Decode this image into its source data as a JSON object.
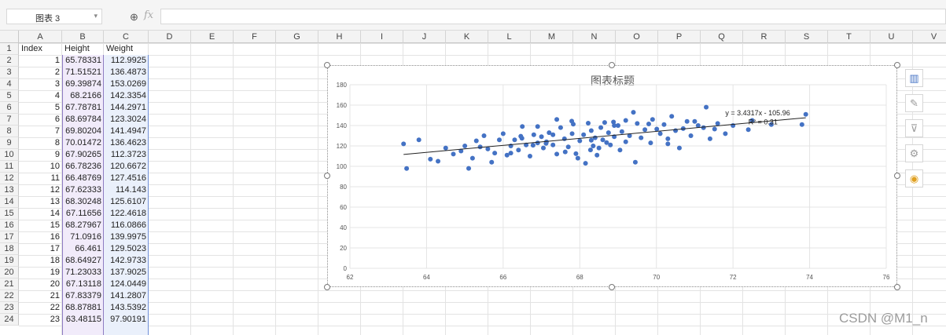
{
  "toolbar": {
    "name_box_value": "图表 3",
    "fx_label": "fx",
    "formula_value": ""
  },
  "columns": [
    "A",
    "B",
    "C",
    "D",
    "E",
    "F",
    "G",
    "H",
    "I",
    "J",
    "K",
    "L",
    "M",
    "N",
    "O",
    "P",
    "Q",
    "R",
    "S",
    "T",
    "U",
    "V"
  ],
  "row_numbers": [
    "1",
    "2",
    "3",
    "4",
    "5",
    "6",
    "7",
    "8",
    "9",
    "10",
    "11",
    "12",
    "13",
    "14",
    "15",
    "16",
    "17",
    "18",
    "19",
    "20",
    "21",
    "22",
    "23",
    "24"
  ],
  "header_row": [
    "Index",
    "Height",
    "Weight"
  ],
  "rows": [
    [
      "1",
      "65.78331",
      "112.9925"
    ],
    [
      "2",
      "71.51521",
      "136.4873"
    ],
    [
      "3",
      "69.39874",
      "153.0269"
    ],
    [
      "4",
      "68.2166",
      "142.3354"
    ],
    [
      "5",
      "67.78781",
      "144.2971"
    ],
    [
      "6",
      "68.69784",
      "123.3024"
    ],
    [
      "7",
      "69.80204",
      "141.4947"
    ],
    [
      "8",
      "70.01472",
      "136.4623"
    ],
    [
      "9",
      "67.90265",
      "112.3723"
    ],
    [
      "10",
      "66.78236",
      "120.6672"
    ],
    [
      "11",
      "66.48769",
      "127.4516"
    ],
    [
      "12",
      "67.62333",
      "114.143"
    ],
    [
      "13",
      "68.30248",
      "125.6107"
    ],
    [
      "14",
      "67.11656",
      "122.4618"
    ],
    [
      "15",
      "68.27967",
      "116.0866"
    ],
    [
      "16",
      "71.0916",
      "139.9975"
    ],
    [
      "17",
      "66.461",
      "129.5023"
    ],
    [
      "18",
      "68.64927",
      "142.9733"
    ],
    [
      "19",
      "71.23033",
      "137.9025"
    ],
    [
      "20",
      "67.13118",
      "124.0449"
    ],
    [
      "21",
      "67.83379",
      "141.2807"
    ],
    [
      "22",
      "68.87881",
      "143.5392"
    ],
    [
      "23",
      "63.48115",
      "97.90191"
    ]
  ],
  "chart_data": {
    "type": "scatter",
    "title": "图表标题",
    "xlim": [
      62,
      76
    ],
    "ylim": [
      0,
      180
    ],
    "x_ticks": [
      "62",
      "64",
      "66",
      "68",
      "70",
      "72",
      "74",
      "76"
    ],
    "y_ticks": [
      "0",
      "20",
      "40",
      "60",
      "80",
      "100",
      "120",
      "140",
      "160",
      "180"
    ],
    "grid": true,
    "trendline": {
      "slope": 3.4317,
      "intercept": -105.96,
      "x_range": [
        63.4,
        73.9
      ]
    },
    "equation_label": "y = 3.4317x - 105.96",
    "r2_label": "R² = 0.31",
    "marker_color": "#4472c4",
    "points": [
      [
        65.78,
        113.0
      ],
      [
        71.52,
        136.5
      ],
      [
        69.4,
        153.0
      ],
      [
        68.22,
        142.3
      ],
      [
        67.79,
        144.3
      ],
      [
        68.7,
        123.3
      ],
      [
        69.8,
        141.5
      ],
      [
        70.01,
        136.5
      ],
      [
        67.9,
        112.4
      ],
      [
        66.78,
        120.7
      ],
      [
        66.49,
        127.5
      ],
      [
        67.62,
        114.1
      ],
      [
        68.3,
        125.6
      ],
      [
        67.12,
        122.5
      ],
      [
        68.28,
        116.1
      ],
      [
        71.09,
        140.0
      ],
      [
        66.46,
        129.5
      ],
      [
        68.65,
        143.0
      ],
      [
        71.23,
        137.9
      ],
      [
        67.13,
        124.0
      ],
      [
        67.83,
        141.3
      ],
      [
        68.88,
        143.5
      ],
      [
        63.48,
        97.9
      ],
      [
        63.4,
        122.0
      ],
      [
        63.8,
        126.0
      ],
      [
        64.1,
        107.0
      ],
      [
        64.3,
        105.0
      ],
      [
        64.5,
        118.0
      ],
      [
        64.7,
        112.0
      ],
      [
        64.9,
        115.0
      ],
      [
        65.0,
        120.0
      ],
      [
        65.2,
        108.0
      ],
      [
        65.3,
        125.0
      ],
      [
        65.4,
        119.0
      ],
      [
        65.5,
        130.0
      ],
      [
        65.6,
        117.0
      ],
      [
        65.7,
        104.0
      ],
      [
        65.9,
        126.0
      ],
      [
        66.0,
        132.0
      ],
      [
        66.1,
        111.0
      ],
      [
        66.2,
        120.0
      ],
      [
        66.3,
        126.0
      ],
      [
        66.4,
        116.0
      ],
      [
        66.5,
        139.0
      ],
      [
        66.6,
        121.0
      ],
      [
        66.7,
        110.0
      ],
      [
        66.8,
        131.0
      ],
      [
        66.9,
        123.0
      ],
      [
        67.0,
        129.0
      ],
      [
        67.05,
        118.0
      ],
      [
        67.2,
        133.0
      ],
      [
        67.3,
        121.0
      ],
      [
        67.4,
        112.0
      ],
      [
        67.5,
        138.0
      ],
      [
        67.6,
        127.0
      ],
      [
        67.7,
        119.0
      ],
      [
        67.8,
        132.0
      ],
      [
        67.95,
        108.0
      ],
      [
        68.0,
        125.0
      ],
      [
        68.1,
        131.0
      ],
      [
        68.15,
        103.0
      ],
      [
        68.3,
        135.0
      ],
      [
        68.35,
        120.0
      ],
      [
        68.4,
        128.0
      ],
      [
        68.5,
        118.0
      ],
      [
        68.55,
        138.0
      ],
      [
        68.6,
        126.0
      ],
      [
        68.75,
        133.0
      ],
      [
        68.8,
        121.0
      ],
      [
        68.9,
        129.0
      ],
      [
        69.0,
        140.0
      ],
      [
        69.05,
        116.0
      ],
      [
        69.1,
        134.0
      ],
      [
        69.2,
        124.0
      ],
      [
        69.3,
        130.0
      ],
      [
        69.45,
        104.0
      ],
      [
        69.5,
        142.0
      ],
      [
        69.6,
        128.0
      ],
      [
        69.7,
        136.0
      ],
      [
        69.85,
        123.0
      ],
      [
        69.9,
        146.0
      ],
      [
        70.1,
        132.0
      ],
      [
        70.2,
        141.0
      ],
      [
        70.3,
        127.0
      ],
      [
        70.4,
        149.0
      ],
      [
        70.5,
        135.0
      ],
      [
        70.6,
        118.0
      ],
      [
        70.8,
        144.0
      ],
      [
        70.9,
        130.0
      ],
      [
        71.3,
        158.0
      ],
      [
        71.4,
        127.0
      ],
      [
        71.6,
        142.0
      ],
      [
        71.8,
        132.0
      ],
      [
        72.0,
        140.0
      ],
      [
        72.5,
        145.0
      ],
      [
        72.4,
        136.0
      ],
      [
        73.0,
        141.0
      ],
      [
        73.8,
        141.0
      ],
      [
        73.9,
        151.0
      ],
      [
        65.1,
        98.0
      ],
      [
        66.9,
        139.0
      ],
      [
        67.4,
        146.0
      ],
      [
        68.45,
        111.0
      ],
      [
        69.2,
        145.0
      ],
      [
        70.7,
        137.0
      ],
      [
        66.2,
        113.0
      ],
      [
        67.3,
        131.0
      ],
      [
        68.9,
        140.0
      ],
      [
        70.3,
        122.0
      ],
      [
        71.0,
        144.0
      ]
    ]
  }
}
